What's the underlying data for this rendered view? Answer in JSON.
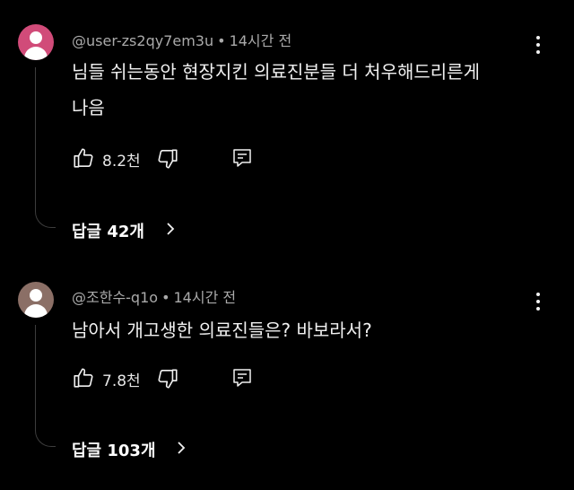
{
  "colors": {
    "background": "#000000",
    "avatar1": "#d14b79",
    "avatar2": "#8b6f66"
  },
  "comments": [
    {
      "author": "@user-zs2qy7em3u",
      "time": "14시간 전",
      "dot": "•",
      "text_line1": "님들 쉬는동안 현장지킨 의료진분들 더 처우해드리른게",
      "text_line2": "나음",
      "likes": "8.2천",
      "replies_label": "답글 42개",
      "icons": [
        "thumbs-up-icon",
        "thumbs-down-icon",
        "reply-icon",
        "more-vert-icon",
        "chevron-right-icon"
      ]
    },
    {
      "author": "@조한수-q1o",
      "time": "14시간 전",
      "dot": "•",
      "text_line1": "남아서 개고생한 의료진들은? 바보라서?",
      "likes": "7.8천",
      "replies_label": "답글 103개",
      "icons": [
        "thumbs-up-icon",
        "thumbs-down-icon",
        "reply-icon",
        "more-vert-icon",
        "chevron-right-icon"
      ]
    }
  ]
}
